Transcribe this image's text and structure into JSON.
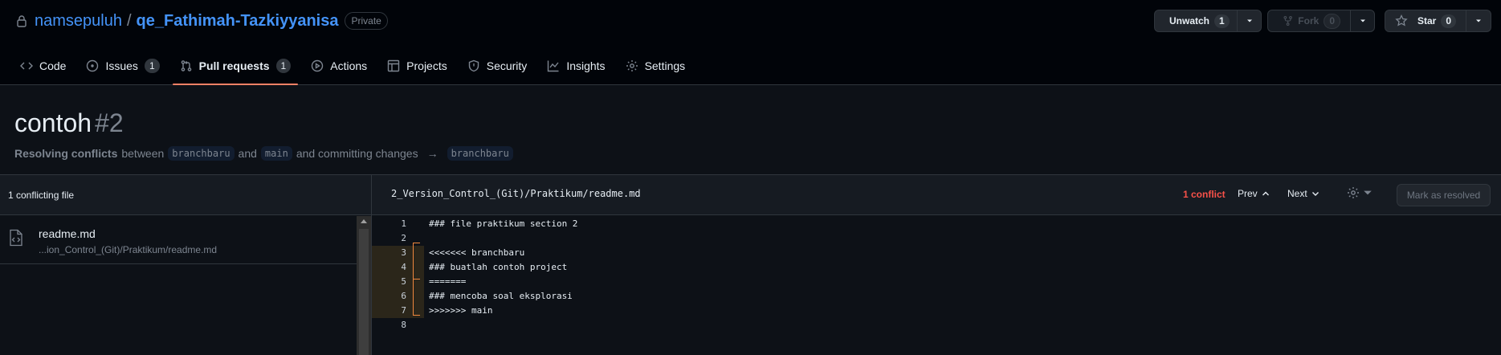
{
  "repo": {
    "owner": "namsepuluh",
    "separator": "/",
    "name": "qe_Fathimah-Tazkiyyanisa",
    "visibility": "Private"
  },
  "actions": {
    "watch": {
      "label": "Unwatch",
      "count": "1"
    },
    "fork": {
      "label": "Fork",
      "count": "0"
    },
    "star": {
      "label": "Star",
      "count": "0"
    }
  },
  "nav": {
    "code": "Code",
    "issues": "Issues",
    "issues_count": "1",
    "pull_requests": "Pull requests",
    "pull_requests_count": "1",
    "actions": "Actions",
    "projects": "Projects",
    "security": "Security",
    "insights": "Insights",
    "settings": "Settings"
  },
  "pr": {
    "title": "contoh",
    "number": "#2",
    "subtitle_bold": "Resolving conflicts",
    "subtitle_between": "between",
    "head_branch": "branchbaru",
    "subtitle_and": "and",
    "base_branch": "main",
    "subtitle_committing": "and committing changes",
    "arrow": "→",
    "target_branch": "branchbaru"
  },
  "files": {
    "header": "1 conflicting file",
    "items": [
      {
        "name": "readme.md",
        "path": "...ion_Control_(Git)/Praktikum/readme.md"
      }
    ]
  },
  "editor": {
    "path": "2_Version_Control_(Git)/Praktikum/readme.md",
    "conflict_count": "1 conflict",
    "prev_label": "Prev",
    "next_label": "Next",
    "mark_resolved": "Mark as resolved",
    "lines": [
      {
        "num": "1",
        "text": "### file praktikum section 2",
        "conflict": false
      },
      {
        "num": "2",
        "text": "",
        "conflict": false
      },
      {
        "num": "3",
        "text": "<<<<<<< branchbaru",
        "conflict": true
      },
      {
        "num": "4",
        "text": "### buatlah contoh project",
        "conflict": true
      },
      {
        "num": "5",
        "text": "=======",
        "conflict": true
      },
      {
        "num": "6",
        "text": "### mencoba soal eksplorasi",
        "conflict": true
      },
      {
        "num": "7",
        "text": ">>>>>>> main",
        "conflict": true
      },
      {
        "num": "8",
        "text": "",
        "conflict": false
      }
    ]
  }
}
